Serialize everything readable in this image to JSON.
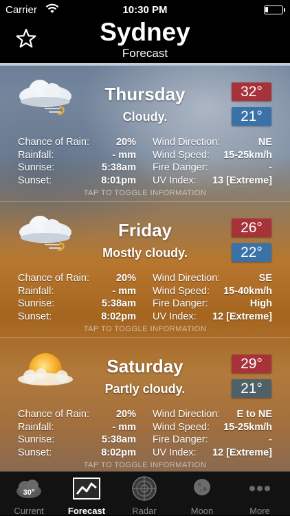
{
  "status": {
    "carrier": "Carrier",
    "time": "10:30 PM"
  },
  "header": {
    "city": "Sydney",
    "subtitle": "Forecast"
  },
  "toggle_label": "TAP TO TOGGLE INFORMATION",
  "days": [
    {
      "name": "Thursday",
      "condition": "Cloudy.",
      "high": "32°",
      "low": "21°",
      "icon": "cloudy-windy-icon",
      "left": [
        {
          "label": "Chance of Rain:",
          "value": "20%"
        },
        {
          "label": "Rainfall:",
          "value": "- mm"
        },
        {
          "label": "Sunrise:",
          "value": "5:38am"
        },
        {
          "label": "Sunset:",
          "value": "8:01pm"
        }
      ],
      "right": [
        {
          "label": "Wind Direction:",
          "value": "NE"
        },
        {
          "label": "Wind Speed:",
          "value": "15-25km/h"
        },
        {
          "label": "Fire Danger:",
          "value": "-"
        },
        {
          "label": "UV Index:",
          "value": "13 [Extreme]"
        }
      ]
    },
    {
      "name": "Friday",
      "condition": "Mostly cloudy.",
      "high": "26°",
      "low": "22°",
      "icon": "cloudy-windy-icon",
      "left": [
        {
          "label": "Chance of Rain:",
          "value": "20%"
        },
        {
          "label": "Rainfall:",
          "value": "- mm"
        },
        {
          "label": "Sunrise:",
          "value": "5:38am"
        },
        {
          "label": "Sunset:",
          "value": "8:02pm"
        }
      ],
      "right": [
        {
          "label": "Wind Direction:",
          "value": "SE"
        },
        {
          "label": "Wind Speed:",
          "value": "15-40km/h"
        },
        {
          "label": "Fire Danger:",
          "value": "High"
        },
        {
          "label": "UV Index:",
          "value": "12 [Extreme]"
        }
      ]
    },
    {
      "name": "Saturday",
      "condition": "Partly cloudy.",
      "high": "29°",
      "low": "21°",
      "icon": "partly-cloudy-sun-icon",
      "left": [
        {
          "label": "Chance of Rain:",
          "value": "20%"
        },
        {
          "label": "Rainfall:",
          "value": "- mm"
        },
        {
          "label": "Sunrise:",
          "value": "5:38am"
        },
        {
          "label": "Sunset:",
          "value": "8:02pm"
        }
      ],
      "right": [
        {
          "label": "Wind Direction:",
          "value": "E to NE"
        },
        {
          "label": "Wind Speed:",
          "value": "15-25km/h"
        },
        {
          "label": "Fire Danger:",
          "value": "-"
        },
        {
          "label": "UV Index:",
          "value": "12 [Extreme]"
        }
      ]
    }
  ],
  "tabs": [
    {
      "label": "Current",
      "icon": "current-weather-icon",
      "badge": "30°"
    },
    {
      "label": "Forecast",
      "icon": "forecast-chart-icon"
    },
    {
      "label": "Radar",
      "icon": "radar-icon"
    },
    {
      "label": "Moon",
      "icon": "moon-icon"
    },
    {
      "label": "More",
      "icon": "more-dots-icon"
    }
  ],
  "colors": {
    "high_temp": "#a8323a",
    "low_temp": "#3a72a8",
    "low_temp_alt": "#4e6168"
  }
}
